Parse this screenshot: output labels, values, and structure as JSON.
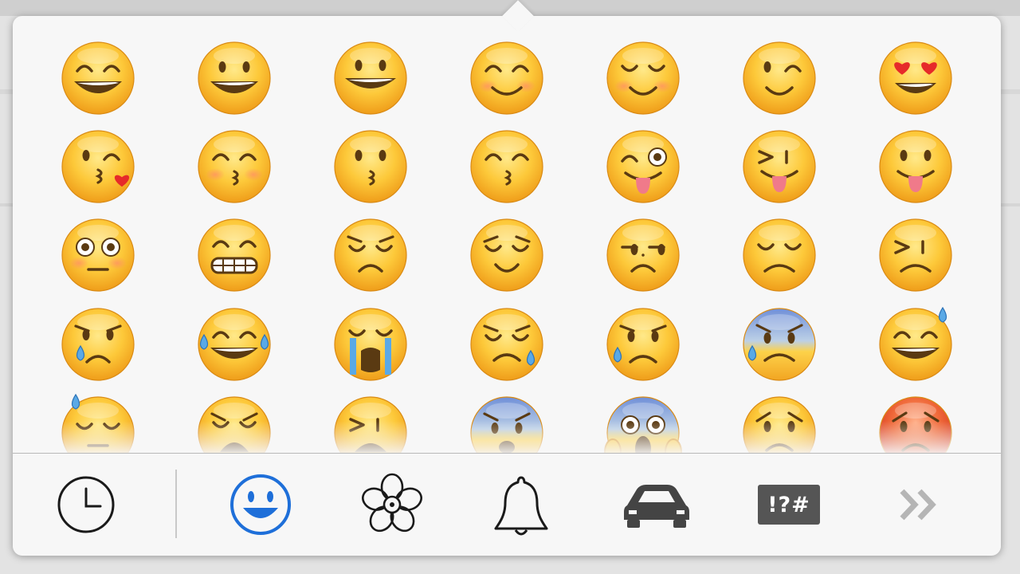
{
  "popover": {
    "emoji_grid": {
      "rows": [
        [
          "grinning-face-with-smiling-eyes",
          "smiling-face-with-open-mouth",
          "grinning-face",
          "smiling-face-with-smiling-eyes",
          "relieved-smile-face",
          "winking-face",
          "smiling-face-with-heart-eyes"
        ],
        [
          "face-blowing-kiss",
          "kissing-face-with-smiling-eyes",
          "kissing-face",
          "kissing-face-closed-eyes",
          "winking-face-with-tongue",
          "squinting-face-with-tongue",
          "face-with-tongue"
        ],
        [
          "flushed-face",
          "grimacing-face",
          "pensive-face",
          "relieved-face",
          "unamused-face",
          "disappointed-face",
          "persevering-face"
        ],
        [
          "crying-face",
          "face-with-tears-of-joy",
          "loudly-crying-face",
          "sleepy-face",
          "disappointed-but-relieved-face",
          "anxious-face-with-sweat",
          "smiling-face-with-sweat"
        ],
        [
          "downcast-face-with-sweat",
          "weary-face",
          "tired-face",
          "fearful-face",
          "face-screaming-in-fear",
          "angry-face",
          "pouting-face"
        ]
      ]
    },
    "toolbar": {
      "categories": [
        {
          "id": "recent",
          "icon": "clock-icon",
          "active": false
        },
        {
          "id": "people",
          "icon": "smiley-icon",
          "active": true
        },
        {
          "id": "nature",
          "icon": "flower-icon",
          "active": false
        },
        {
          "id": "objects",
          "icon": "bell-icon",
          "active": false
        },
        {
          "id": "places",
          "icon": "car-icon",
          "active": false
        },
        {
          "id": "symbols",
          "icon": "symbols-icon",
          "label": "!?#",
          "active": false
        },
        {
          "id": "more",
          "icon": "double-chevron-right-icon",
          "active": false
        }
      ],
      "active_color": "#1e6fd9",
      "icon_color": "#1a1a1a",
      "disabled_color": "#b5b5b5"
    }
  }
}
